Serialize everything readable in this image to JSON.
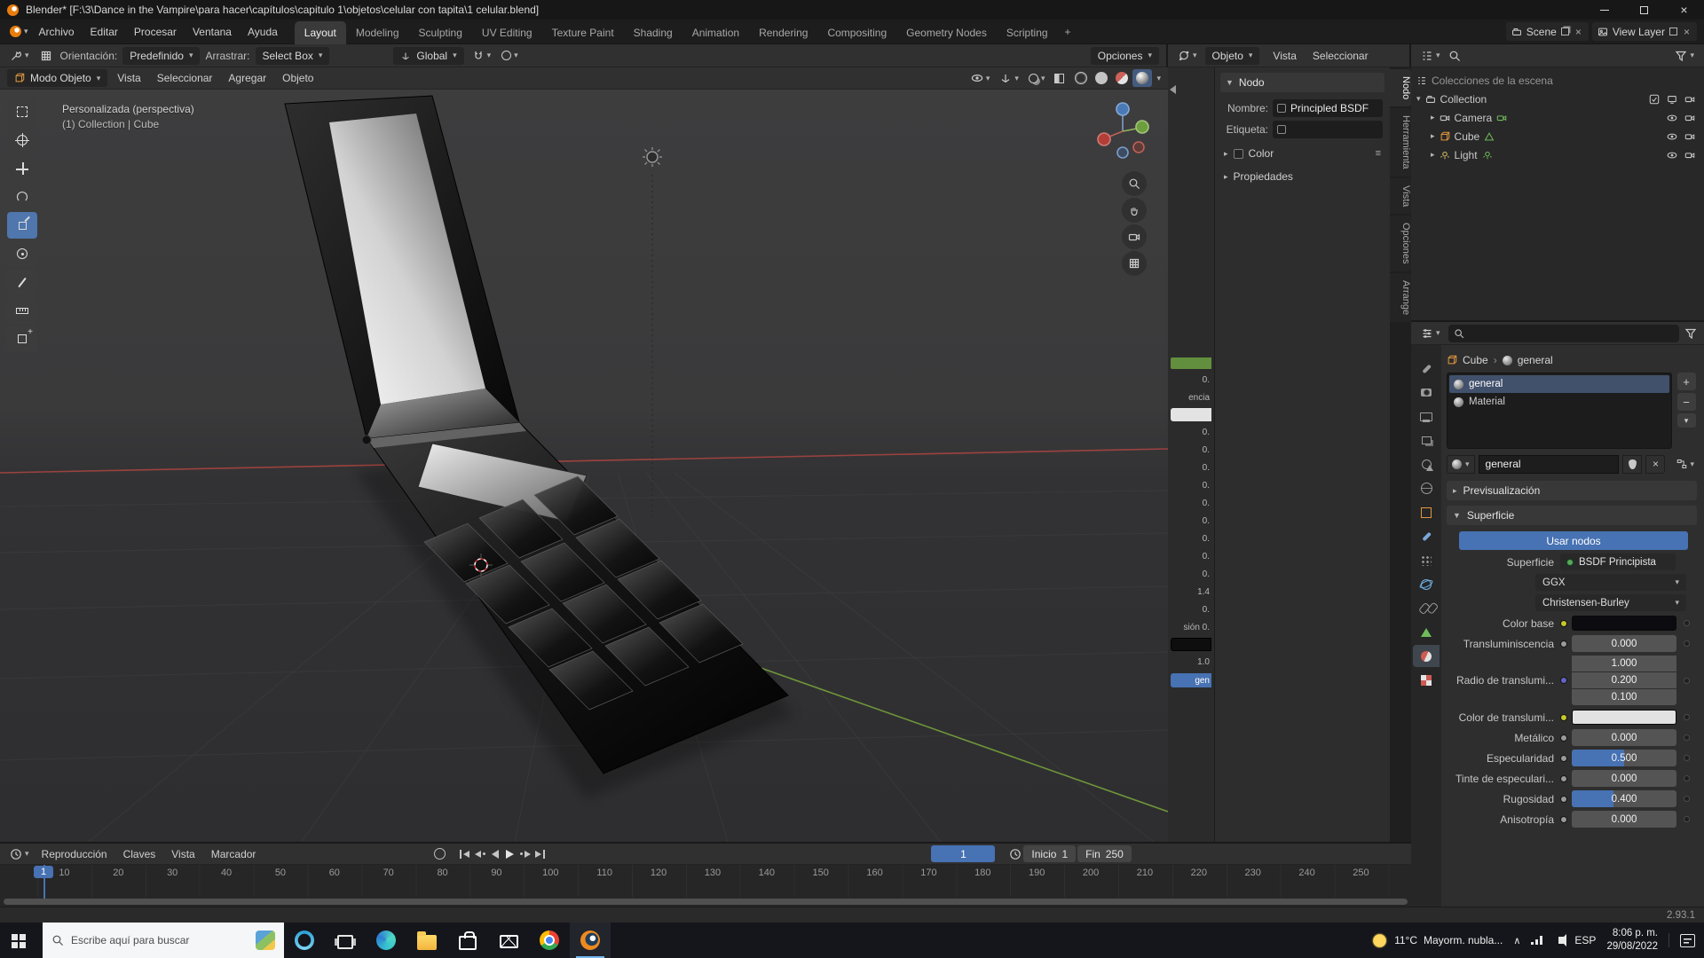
{
  "window": {
    "title": "Blender* [F:\\3\\Dance in the Vampire\\para hacer\\capítulos\\capitulo 1\\objetos\\celular con tapita\\1 celular.blend]"
  },
  "menubar": {
    "menus": [
      "Archivo",
      "Editar",
      "Procesar",
      "Ventana",
      "Ayuda"
    ],
    "workspaces": [
      {
        "label": "Layout",
        "active": true
      },
      {
        "label": "Modeling"
      },
      {
        "label": "Sculpting"
      },
      {
        "label": "UV Editing"
      },
      {
        "label": "Texture Paint"
      },
      {
        "label": "Shading"
      },
      {
        "label": "Animation"
      },
      {
        "label": "Rendering"
      },
      {
        "label": "Compositing"
      },
      {
        "label": "Geometry Nodes"
      },
      {
        "label": "Scripting"
      }
    ],
    "add_workspace": "+",
    "scene_label": "Scene",
    "view_layer_label": "View Layer"
  },
  "tool_settings": {
    "orientation_label": "Orientación:",
    "orientation_value": "Predefinido",
    "drag_label": "Arrastrar:",
    "drag_value": "Select Box",
    "transform_orientation": "Global",
    "options_label": "Opciones"
  },
  "viewport": {
    "header": {
      "mode_label": "Modo Objeto",
      "menus": [
        "Vista",
        "Seleccionar",
        "Agregar",
        "Objeto"
      ]
    },
    "tools": [
      {
        "icon": "select-box"
      },
      {
        "icon": "cursor"
      },
      {
        "icon": "move"
      },
      {
        "icon": "rotate"
      },
      {
        "icon": "scale",
        "active": true
      },
      {
        "icon": "transform"
      },
      {
        "icon": "annotate"
      },
      {
        "icon": "measure"
      },
      {
        "icon": "add-cube"
      }
    ],
    "shading": [
      {
        "icon": "wireframe"
      },
      {
        "icon": "solid"
      },
      {
        "icon": "material"
      },
      {
        "icon": "rendered",
        "active": true
      }
    ],
    "view_name": "Personalizada (perspectiva)",
    "active_path": "(1) Collection | Cube"
  },
  "shader": {
    "header": {
      "type_value": "Objeto",
      "menus": [
        "Vista",
        "Seleccionar"
      ]
    },
    "sliver": {
      "top_values": [
        "0."
      ],
      "label1": "encia",
      "mid_values": [
        "0.",
        "0.",
        "0.",
        "0.",
        "0.",
        "0.",
        "0.",
        "0.",
        "0.",
        "1.4",
        "0.",
        "sión  0."
      ],
      "last_value": "1.0",
      "button_label": "gen"
    },
    "node_panel": {
      "section": "Nodo",
      "name_label": "Nombre:",
      "name_value": "Principled BSDF",
      "label_label": "Etiqueta:",
      "color_section": "Color",
      "props_section": "Propiedades"
    },
    "tabs": [
      {
        "label": "Nodo",
        "active": true
      },
      {
        "label": "Herramienta"
      },
      {
        "label": "Vista"
      },
      {
        "label": "Opciones"
      },
      {
        "label": "Arrange"
      }
    ]
  },
  "outliner": {
    "scene_label": "Colecciones de la escena",
    "collection_name": "Collection",
    "objects": {
      "camera": "Camera",
      "cube": "Cube",
      "light": "Light"
    }
  },
  "properties": {
    "breadcrumb_object": "Cube",
    "breadcrumb_data": "general",
    "slots": [
      {
        "name": "general",
        "active": true
      },
      {
        "name": "Material"
      }
    ],
    "datablock_name": "general",
    "preview_section": "Previsualización",
    "surface_section": "Superficie",
    "use_nodes_label": "Usar nodos",
    "surface_label": "Superficie",
    "surface_value": "BSDF Principista",
    "distribution": "GGX",
    "subsurface_method": "Christensen-Burley",
    "base_color_label": "Color base",
    "base_color": "#0c0c10",
    "subsurface_label": "Transluminiscencia",
    "subsurface_value": "0.000",
    "radius_label": "Radio de translumi...",
    "radius_values": [
      "1.000",
      "0.200",
      "0.100"
    ],
    "subsurface_color_label": "Color de translumi...",
    "subsurface_color": "#e2e2e2",
    "sliders": [
      {
        "label": "Metálico",
        "value": "0.000",
        "fill_pct": 0
      },
      {
        "label": "Especularidad",
        "value": "0.500",
        "fill_pct": 50
      },
      {
        "label": "Tinte de especulari...",
        "value": "0.000",
        "fill_pct": 0
      },
      {
        "label": "Rugosidad",
        "value": "0.400",
        "fill_pct": 40
      },
      {
        "label": "Anisotropía",
        "value": "0.000",
        "fill_pct": 0
      }
    ],
    "tabs": [
      {
        "icon": "tool"
      },
      {
        "icon": "render"
      },
      {
        "icon": "output"
      },
      {
        "icon": "view-layer"
      },
      {
        "icon": "scene"
      },
      {
        "icon": "world"
      },
      {
        "icon": "object"
      },
      {
        "icon": "modifiers"
      },
      {
        "icon": "particles"
      },
      {
        "icon": "physics"
      },
      {
        "icon": "constraints"
      },
      {
        "icon": "data"
      },
      {
        "icon": "material",
        "active": true
      },
      {
        "icon": "texture"
      }
    ]
  },
  "timeline": {
    "menus": [
      "Reproducción",
      "Claves",
      "Vista",
      "Marcador"
    ],
    "transport": [
      {
        "icon": "jump-start"
      },
      {
        "icon": "prev-key"
      },
      {
        "icon": "play-back"
      },
      {
        "icon": "play"
      },
      {
        "icon": "next-key"
      },
      {
        "icon": "jump-end"
      }
    ],
    "current_frame": "1",
    "start_label": "Inicio",
    "start_value": "1",
    "end_label": "Fin",
    "end_value": "250",
    "ticks": [
      "10",
      "20",
      "30",
      "40",
      "50",
      "60",
      "70",
      "80",
      "90",
      "100",
      "110",
      "120",
      "130",
      "140",
      "150",
      "160",
      "170",
      "180",
      "190",
      "200",
      "210",
      "220",
      "230",
      "240",
      "250"
    ]
  },
  "status": {
    "version": "2.93.1"
  },
  "taskbar": {
    "search_placeholder": "Escribe aquí para buscar",
    "apps": [
      {
        "icon": "cortana"
      },
      {
        "icon": "task-view"
      },
      {
        "icon": "edge"
      },
      {
        "icon": "explorer"
      },
      {
        "icon": "store"
      },
      {
        "icon": "mail"
      },
      {
        "icon": "chrome"
      },
      {
        "icon": "blender",
        "active": true
      }
    ],
    "weather_temp": "11°C",
    "weather_desc": "Mayorm. nubla...",
    "lang": "ESP",
    "time": "8:06 p. m.",
    "date": "29/08/2022"
  }
}
